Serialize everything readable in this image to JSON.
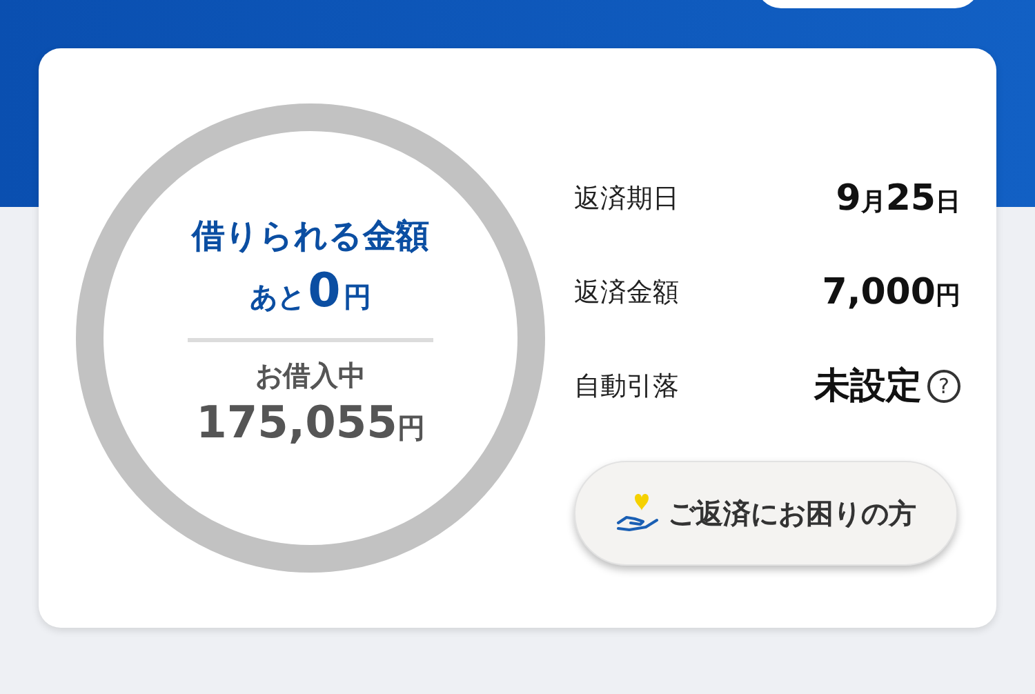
{
  "summary": {
    "available_label": "借りられる金額",
    "remaining": [
      {
        "text": "あと",
        "kind": "unit"
      },
      {
        "text": "0",
        "kind": "number"
      },
      {
        "text": "円",
        "kind": "unit"
      }
    ],
    "borrowing_label": "お借入中",
    "borrowing": [
      {
        "text": "175,055",
        "kind": "number"
      },
      {
        "text": "円",
        "kind": "unit"
      }
    ]
  },
  "details": [
    {
      "label": "返済期日",
      "value": [
        {
          "text": "9",
          "kind": "number"
        },
        {
          "text": "月",
          "kind": "unit"
        },
        {
          "text": "25",
          "kind": "number"
        },
        {
          "text": "日",
          "kind": "unit"
        }
      ]
    },
    {
      "label": "返済金額",
      "value": [
        {
          "text": "7,000",
          "kind": "number"
        },
        {
          "text": "円",
          "kind": "unit"
        }
      ]
    },
    {
      "label": "自動引落",
      "value": [
        {
          "text": "未設定",
          "kind": "number"
        }
      ],
      "help": "?"
    }
  ],
  "help_button": {
    "label": "ご返済にお困りの方"
  }
}
